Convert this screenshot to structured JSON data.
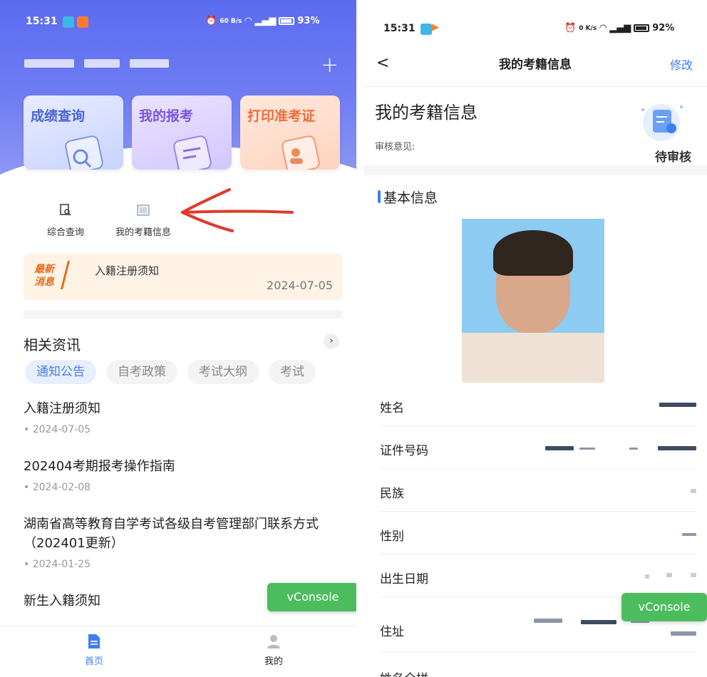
{
  "colors": {
    "accent_blue": "#3d7ef2",
    "header_gradient": "#5b6cf0",
    "orange": "#e36a1d",
    "vconsole_green": "#4bbd5e"
  },
  "left": {
    "status_bar": {
      "time": "15:31",
      "net": "60 B/s",
      "battery": "93%"
    },
    "header": {
      "plus": "+"
    },
    "cards": [
      {
        "label": "成绩查询",
        "icon": "score-query-icon"
      },
      {
        "label": "我的报考",
        "icon": "my-registration-icon"
      },
      {
        "label": "打印准考证",
        "icon": "print-ticket-icon"
      }
    ],
    "quick_links": [
      {
        "label": "综合查询",
        "icon": "search-doc-icon"
      },
      {
        "label": "我的考籍信息",
        "icon": "image-icon"
      }
    ],
    "news_banner": {
      "tag_line1": "最新",
      "tag_line2": "消息",
      "title": "入籍注册须知",
      "date": "2024-07-05"
    },
    "section": {
      "title": "相关资讯",
      "more": "›"
    },
    "tabs": [
      "通知公告",
      "自考政策",
      "考试大纲",
      "考试"
    ],
    "articles": [
      {
        "title": "入籍注册须知",
        "date": "2024-07-05"
      },
      {
        "title": "202404考期报考操作指南",
        "date": "2024-02-08"
      },
      {
        "title": "湖南省高等教育自学考试各级自考管理部门联系方式（202401更新）",
        "date": "2024-01-25"
      },
      {
        "title": "新生入籍须知",
        "date": ""
      }
    ],
    "vconsole": "vConsole",
    "bottom_nav": [
      {
        "label": "首页",
        "icon": "home-doc-icon"
      },
      {
        "label": "我的",
        "icon": "person-icon"
      }
    ]
  },
  "right": {
    "status_bar": {
      "time": "15:31",
      "net": "0 K/s",
      "battery": "92%"
    },
    "nav": {
      "back": "<",
      "title": "我的考籍信息",
      "edit": "修改"
    },
    "heading": "我的考籍信息",
    "review_label": "审核意见:",
    "status": "待审核",
    "section": "基本信息",
    "fields": [
      {
        "label": "姓名"
      },
      {
        "label": "证件号码"
      },
      {
        "label": "民族"
      },
      {
        "label": "性别"
      },
      {
        "label": "出生日期"
      },
      {
        "label": "住址"
      },
      {
        "label": "姓名全拼"
      }
    ],
    "vconsole": "vConsole"
  }
}
